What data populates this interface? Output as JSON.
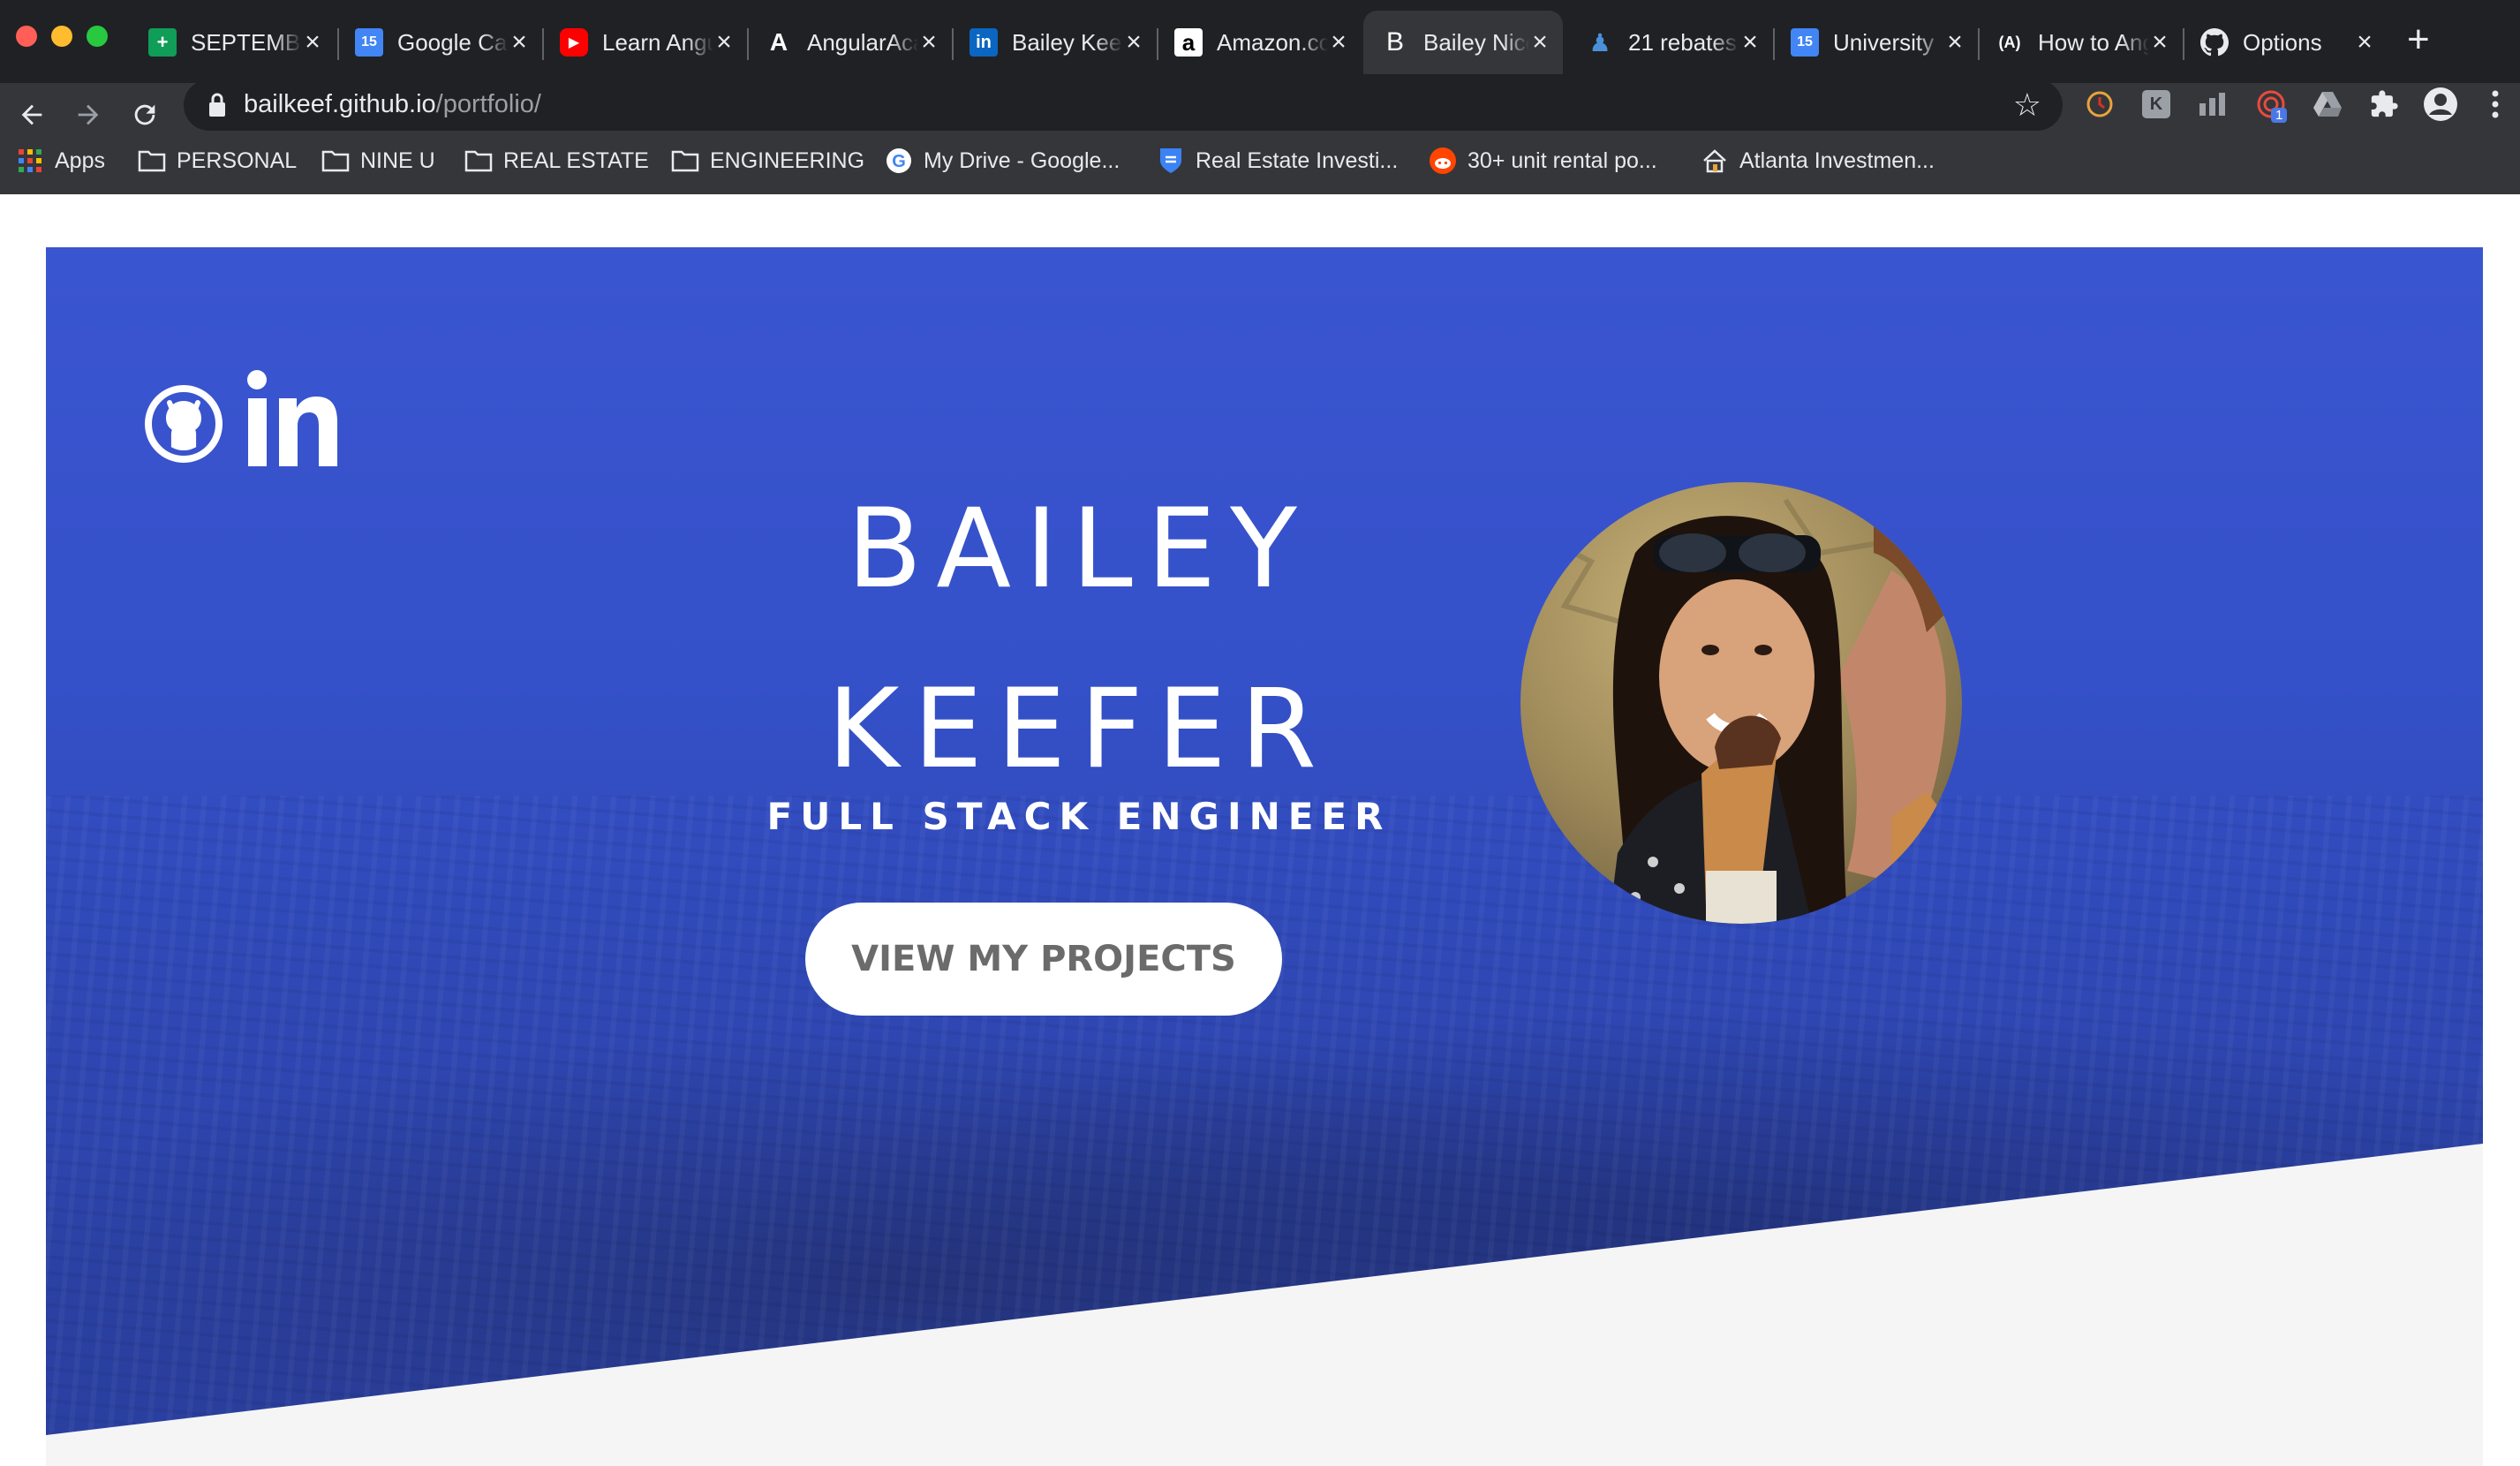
{
  "browser": {
    "tabs": [
      {
        "title": "SEPTEMBER",
        "icon": "sheets-icon",
        "color": "#0f9d58",
        "glyph": "+"
      },
      {
        "title": "Google Calendar",
        "icon": "calendar-icon",
        "color": "#4285f4",
        "glyph": "15"
      },
      {
        "title": "Learn Angular",
        "icon": "youtube-icon",
        "color": "#ff0000",
        "glyph": "▶"
      },
      {
        "title": "AngularAcademy",
        "icon": "angular-academy-icon",
        "color": "#202124",
        "glyph": "A"
      },
      {
        "title": "Bailey Keefer",
        "icon": "linkedin-icon",
        "color": "#0a66c2",
        "glyph": "in"
      },
      {
        "title": "Amazon.com",
        "icon": "amazon-icon",
        "color": "#ffffff",
        "glyph": "a"
      },
      {
        "title": "Bailey Nicole",
        "icon": "b-icon",
        "color": "#35363a",
        "glyph": "B"
      },
      {
        "title": "21 rebates",
        "icon": "person-icon",
        "color": "#4a90d9",
        "glyph": "♟"
      },
      {
        "title": "University",
        "icon": "calendar-icon",
        "color": "#4285f4",
        "glyph": "15"
      },
      {
        "title": "How to Angular",
        "icon": "angular-a-icon",
        "color": "#202124",
        "glyph": "(A)"
      },
      {
        "title": "Options",
        "icon": "github-icon",
        "color": "#202124",
        "glyph": ""
      }
    ],
    "active_tab_index": 6,
    "url_host": "bailkeef.github.io",
    "url_path": "/portfolio/",
    "bookmarks": [
      {
        "label": "Apps",
        "icon": "apps-grid-icon"
      },
      {
        "label": "PERSONAL",
        "icon": "folder-icon"
      },
      {
        "label": "NINE U",
        "icon": "folder-icon"
      },
      {
        "label": "REAL ESTATE",
        "icon": "folder-icon"
      },
      {
        "label": "ENGINEERING",
        "icon": "folder-icon"
      },
      {
        "label": "My Drive - Google...",
        "icon": "google-icon"
      },
      {
        "label": "Real Estate Investi...",
        "icon": "shield-icon"
      },
      {
        "label": "30+ unit rental po...",
        "icon": "reddit-icon"
      },
      {
        "label": "Atlanta Investmen...",
        "icon": "house-icon"
      }
    ],
    "extension_badge": "1"
  },
  "hero": {
    "name_first": "BAILEY",
    "name_last": "KEEFER",
    "role": "FULL STACK ENGINEER",
    "cta_label": "VIEW MY PROJECTS",
    "accent_color": "#3551c9",
    "social_icons": [
      "github-icon",
      "linkedin-icon"
    ]
  }
}
